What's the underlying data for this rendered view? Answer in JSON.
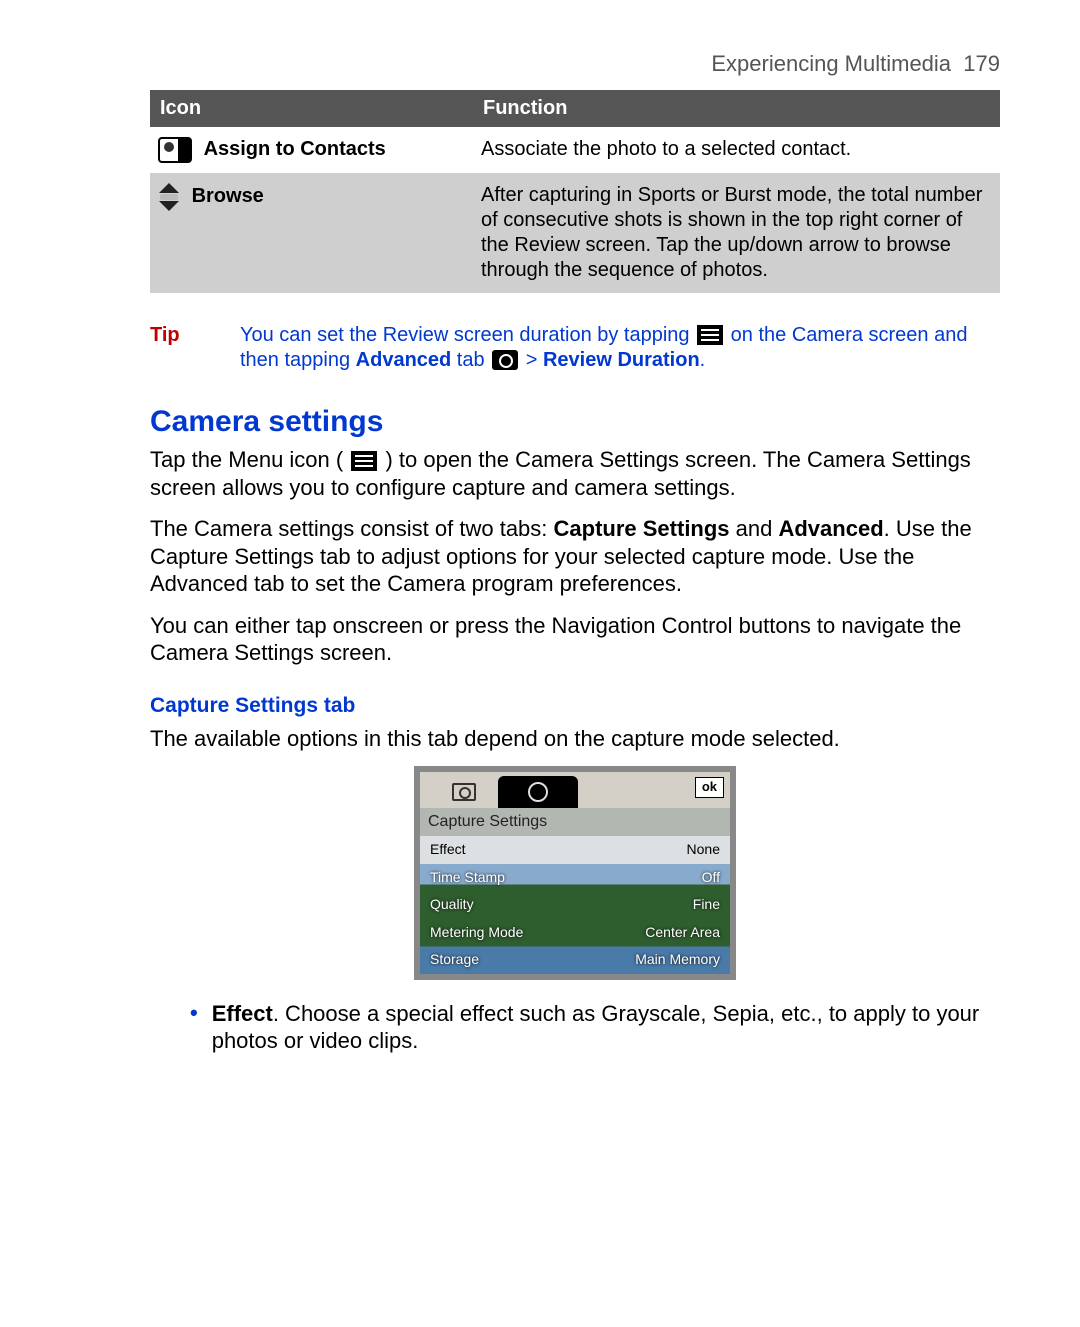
{
  "header": {
    "chapter": "Experiencing Multimedia",
    "page": "179"
  },
  "table": {
    "head": {
      "icon": "Icon",
      "fn": "Function"
    },
    "rows": [
      {
        "label": "Assign to Contacts",
        "fn": "Associate the photo to a selected contact."
      },
      {
        "label": "Browse",
        "fn": "After capturing in Sports or Burst mode, the total number of consecutive shots is shown in the top right corner of the Review screen. Tap the up/down arrow to browse through the sequence of photos."
      }
    ]
  },
  "tip": {
    "label": "Tip",
    "t1": "You can set the Review screen duration by tapping ",
    "t2": " on the Camera screen and then tapping ",
    "b1": "Advanced",
    "t3": " tab ",
    "gt": " > ",
    "b2": "Review Duration",
    "t4": "."
  },
  "h2": "Camera settings",
  "p1a": "Tap the Menu icon ( ",
  "p1b": " ) to open the Camera Settings screen. The Camera Settings screen allows you to configure capture and camera settings.",
  "p2a": "The Camera settings consist of two tabs: ",
  "p2b1": "Capture Settings",
  "p2c": " and ",
  "p2b2": "Advanced",
  "p2d": ". Use the Capture Settings tab to adjust options for your selected capture mode. Use the Advanced tab to set the Camera program preferences.",
  "p3": "You can either tap onscreen or press the Navigation Control buttons to navigate the Camera Settings screen.",
  "h3": "Capture Settings tab",
  "p4": "The available options in this tab depend on the capture mode selected.",
  "screenshot": {
    "ok": "ok",
    "title": "Capture Settings",
    "rows": [
      {
        "k": "Effect",
        "v": "None"
      },
      {
        "k": "Time Stamp",
        "v": "Off"
      },
      {
        "k": "Quality",
        "v": "Fine"
      },
      {
        "k": "Metering Mode",
        "v": "Center Area"
      },
      {
        "k": "Storage",
        "v": "Main Memory"
      }
    ]
  },
  "bullet": {
    "b": "Effect",
    "t": ". Choose a special effect such as Grayscale, Sepia, etc., to apply to your photos or video clips."
  }
}
